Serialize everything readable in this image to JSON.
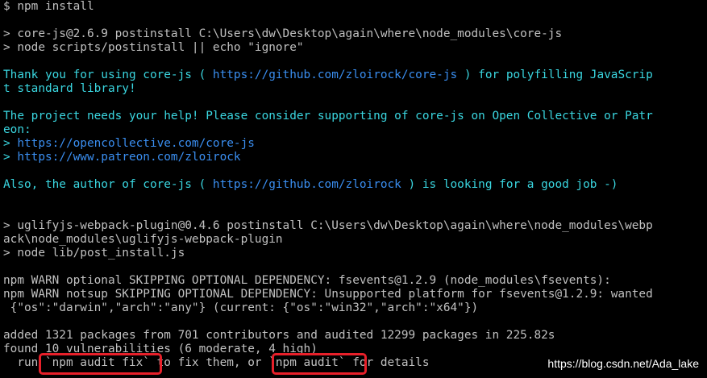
{
  "colors": {
    "background": "#000000",
    "default_text": "#c0c0c0",
    "accent_text": "#3ad6e0",
    "link_text": "#3a8ef0",
    "highlight_box": "#e8202a"
  },
  "terminal": {
    "lines": [
      "$ npm install",
      "",
      "> core-js@2.6.9 postinstall C:\\Users\\dw\\Desktop\\again\\where\\node_modules\\core-js",
      "> node scripts/postinstall || echo \"ignore\"",
      "",
      "Thank you for using core-js ( https://github.com/zloirock/core-js ) for polyfilling JavaScrip",
      "t standard library!",
      "",
      "The project needs your help! Please consider supporting of core-js on Open Collective or Patr",
      "eon:",
      "> https://opencollective.com/core-js",
      "> https://www.patreon.com/zloirock",
      "",
      "Also, the author of core-js ( https://github.com/zloirock ) is looking for a good job -)",
      "",
      "",
      "> uglifyjs-webpack-plugin@0.4.6 postinstall C:\\Users\\dw\\Desktop\\again\\where\\node_modules\\webp",
      "ack\\node_modules\\uglifyjs-webpack-plugin",
      "> node lib/post_install.js",
      "",
      "npm WARN optional SKIPPING OPTIONAL DEPENDENCY: fsevents@1.2.9 (node_modules\\fsevents):",
      "npm WARN notsup SKIPPING OPTIONAL DEPENDENCY: Unsupported platform for fsevents@1.2.9: wanted",
      " {\"os\":\"darwin\",\"arch\":\"any\"} (current: {\"os\":\"win32\",\"arch\":\"x64\"})",
      "",
      "added 1321 packages from 701 contributors and audited 12299 packages in 225.82s",
      "found 10 vulnerabilities (6 moderate, 4 high)",
      "  run `npm audit fix` to fix them, or `npm audit` for details"
    ],
    "styled_segments": {
      "thank_you": [
        "Thank you for using core-js ( ",
        "https://github.com/zloirock/core-js",
        " ) for polyfilling JavaScrip"
      ],
      "thank_you_cont": "t standard library!",
      "project_help": "The project needs your help! Please consider supporting of core-js on Open Collective or Patr",
      "project_help_cont": "eon:",
      "link_opencollective": [
        "> ",
        "https://opencollective.com/core-js"
      ],
      "link_patreon": [
        "> ",
        "https://www.patreon.com/zloirock"
      ],
      "author": [
        "Also, the author of core-js ( ",
        "https://github.com/zloirock",
        " ) is looking for a good job -)"
      ]
    }
  },
  "watermark": "https://blog.csdn.net/Ada_lake"
}
